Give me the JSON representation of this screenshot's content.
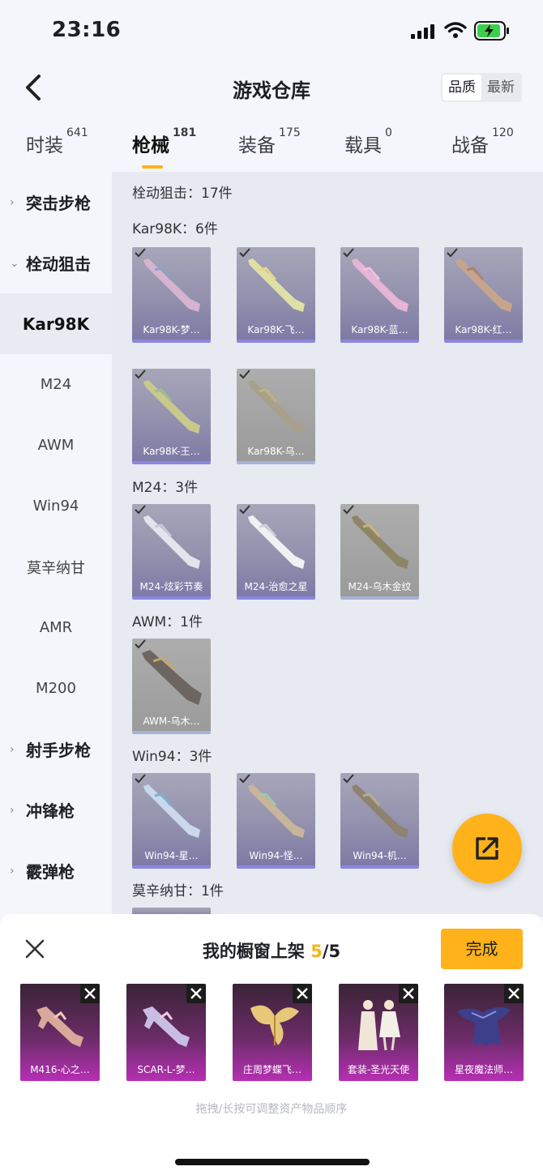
{
  "status": {
    "time": "23:16"
  },
  "header": {
    "title": "游戏仓库",
    "sort_quality": "品质",
    "sort_newest": "最新"
  },
  "tabs": [
    {
      "label": "时装",
      "count": "641"
    },
    {
      "label": "枪械",
      "count": "181"
    },
    {
      "label": "装备",
      "count": "175"
    },
    {
      "label": "载具",
      "count": "0"
    },
    {
      "label": "战备",
      "count": "120"
    }
  ],
  "sidebar": {
    "items": [
      {
        "label": "突击步枪"
      },
      {
        "label": "栓动狙击"
      },
      {
        "label": "Kar98K"
      },
      {
        "label": "M24"
      },
      {
        "label": "AWM"
      },
      {
        "label": "Win94"
      },
      {
        "label": "莫辛纳甘"
      },
      {
        "label": "AMR"
      },
      {
        "label": "M200"
      },
      {
        "label": "射手步枪"
      },
      {
        "label": "冲锋枪"
      },
      {
        "label": "霰弹枪"
      }
    ]
  },
  "content": {
    "category_title": "栓动狙击：17件",
    "groups": [
      {
        "title": "Kar98K：6件",
        "items": [
          "Kar98K-梦…",
          "Kar98K-飞…",
          "Kar98K-蓝…",
          "Kar98K-红…",
          "Kar98K-王…",
          "Kar98K-乌…"
        ]
      },
      {
        "title": "M24：3件",
        "items": [
          "M24-炫彩节奏",
          "M24-治愈之星",
          "M24-乌木金纹"
        ]
      },
      {
        "title": "AWM：1件",
        "items": [
          "AWM-乌木…"
        ]
      },
      {
        "title": "Win94：3件",
        "items": [
          "Win94-星…",
          "Win94-怪…",
          "Win94-机…"
        ]
      },
      {
        "title": "莫辛纳甘：1件",
        "items": []
      }
    ]
  },
  "showcase": {
    "title_prefix": "我的橱窗上架 ",
    "current": "5",
    "total_suffix": "/5",
    "done_label": "完成",
    "slots": [
      "M416-心之…",
      "SCAR-L-梦…",
      "庄周梦蝶飞…",
      "套装-圣光天使",
      "星夜魔法师…"
    ],
    "hint": "拖拽/长按可调整资产物品顺序"
  },
  "colors": {
    "accent": "#ffb21a",
    "rare_purple": "#b62fb4"
  }
}
